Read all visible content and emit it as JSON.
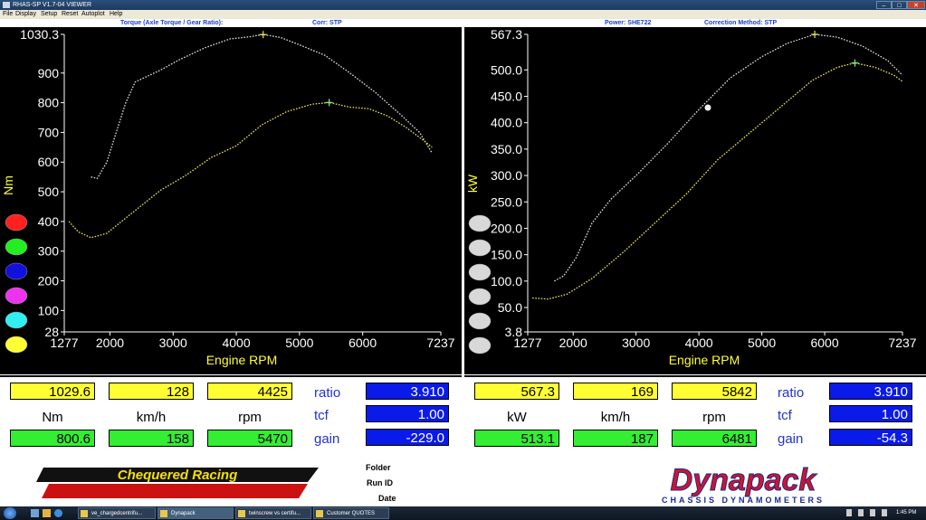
{
  "window": {
    "title": "RHAS-SP V1.7-04  VIEWER"
  },
  "menu": [
    "File",
    "Display",
    "Setup",
    "Reset",
    "Autoplot",
    "Help"
  ],
  "headers": {
    "left_title": "Torque (Axle Torque / Gear Ratio):",
    "left_corr": "Corr: STP",
    "right_power": "Power: SHE722",
    "right_corr": "Correction Method: STP"
  },
  "chart_data": [
    {
      "type": "line",
      "ylabel": "Nm",
      "xlabel": "Engine RPM",
      "xlim": [
        1277,
        7237
      ],
      "ylim": [
        28,
        1030.3
      ],
      "x_ticks": [
        "1277",
        "2000",
        "3000",
        "4000",
        "5000",
        "6000",
        "7237"
      ],
      "y_ticks": [
        "1030.3",
        "900",
        "800",
        "700",
        "600",
        "500",
        "400",
        "300",
        "200",
        "100",
        "28"
      ],
      "grid": false,
      "series": [
        {
          "color": "#e0e0e0",
          "points": [
            [
              1700,
              550
            ],
            [
              1800,
              545
            ],
            [
              1950,
              600
            ],
            [
              2100,
              700
            ],
            [
              2250,
              800
            ],
            [
              2400,
              870
            ],
            [
              2550,
              885
            ],
            [
              2800,
              910
            ],
            [
              3100,
              945
            ],
            [
              3500,
              985
            ],
            [
              3900,
              1015
            ],
            [
              4200,
              1022
            ],
            [
              4425,
              1029.6
            ],
            [
              4700,
              1020
            ],
            [
              5000,
              995
            ],
            [
              5400,
              960
            ],
            [
              5800,
              900
            ],
            [
              6200,
              835
            ],
            [
              6600,
              760
            ],
            [
              6900,
              700
            ],
            [
              7100,
              630
            ]
          ]
        },
        {
          "color": "#e6e655",
          "points": [
            [
              1350,
              400
            ],
            [
              1500,
              365
            ],
            [
              1700,
              345
            ],
            [
              1950,
              360
            ],
            [
              2300,
              420
            ],
            [
              2800,
              505
            ],
            [
              3200,
              555
            ],
            [
              3600,
              615
            ],
            [
              4000,
              655
            ],
            [
              4400,
              725
            ],
            [
              4800,
              770
            ],
            [
              5200,
              795
            ],
            [
              5470,
              800.6
            ],
            [
              5800,
              785
            ],
            [
              6100,
              780
            ],
            [
              6400,
              755
            ],
            [
              6700,
              715
            ],
            [
              6950,
              675
            ],
            [
              7100,
              650
            ]
          ]
        }
      ],
      "markers": [
        {
          "x": 4425,
          "y": 1029.6,
          "color": "#e6e655"
        },
        {
          "x": 5470,
          "y": 800.6,
          "color": "#88ee88"
        }
      ]
    },
    {
      "type": "line",
      "ylabel": "kW",
      "xlabel": "Engine RPM",
      "xlim": [
        1277,
        7237
      ],
      "ylim": [
        3.8,
        567.3
      ],
      "x_ticks": [
        "1277",
        "2000",
        "3000",
        "4000",
        "5000",
        "6000",
        "7237"
      ],
      "y_ticks": [
        "567.3",
        "500.0",
        "450.0",
        "400.0",
        "350.0",
        "300.0",
        "250.0",
        "200.0",
        "150.0",
        "100.0",
        "50.0",
        "3.8"
      ],
      "grid": false,
      "series": [
        {
          "color": "#e0e0e0",
          "points": [
            [
              1700,
              100
            ],
            [
              1850,
              110
            ],
            [
              2050,
              145
            ],
            [
              2300,
              210
            ],
            [
              2600,
              255
            ],
            [
              3000,
              300
            ],
            [
              3500,
              360
            ],
            [
              4000,
              425
            ],
            [
              4500,
              485
            ],
            [
              5000,
              525
            ],
            [
              5400,
              550
            ],
            [
              5842,
              567.3
            ],
            [
              6200,
              562
            ],
            [
              6600,
              545
            ],
            [
              7000,
              518
            ],
            [
              7237,
              490
            ]
          ]
        },
        {
          "color": "#e6e655",
          "points": [
            [
              1350,
              68
            ],
            [
              1600,
              66
            ],
            [
              1900,
              75
            ],
            [
              2300,
              105
            ],
            [
              2800,
              155
            ],
            [
              3300,
              210
            ],
            [
              3800,
              265
            ],
            [
              4300,
              330
            ],
            [
              4800,
              380
            ],
            [
              5300,
              430
            ],
            [
              5800,
              480
            ],
            [
              6200,
              505
            ],
            [
              6481,
              513.1
            ],
            [
              6800,
              505
            ],
            [
              7100,
              490
            ],
            [
              7237,
              478
            ]
          ]
        }
      ],
      "markers": [
        {
          "x": 5842,
          "y": 567.3,
          "color": "#e6e655"
        },
        {
          "x": 6481,
          "y": 513.1,
          "color": "#88ee88"
        }
      ]
    }
  ],
  "left_panel": {
    "unit": "Nm",
    "yellow": {
      "value": "1029.6",
      "speed": "128",
      "rpm": "4425"
    },
    "green": {
      "value": "800.6",
      "speed": "158",
      "rpm": "5470"
    },
    "labels": {
      "speed": "km/h",
      "rpm": "rpm"
    },
    "ratio_label": "ratio",
    "ratio": "3.910",
    "tcf_label": "tcf",
    "tcf": "1.00",
    "gain_label": "gain",
    "gain": "-229.0"
  },
  "right_panel": {
    "unit": "kW",
    "yellow": {
      "value": "567.3",
      "speed": "169",
      "rpm": "5842"
    },
    "green": {
      "value": "513.1",
      "speed": "187",
      "rpm": "6481"
    },
    "labels": {
      "speed": "km/h",
      "rpm": "rpm"
    },
    "ratio_label": "ratio",
    "ratio": "3.910",
    "tcf_label": "tcf",
    "tcf": "1.00",
    "gain_label": "gain",
    "gain": "-54.3"
  },
  "colors": {
    "swatches": [
      "#ff2020",
      "#22ee22",
      "#1111dd",
      "#ee33ee",
      "#33eeee",
      "#ffff33"
    ]
  },
  "footer": {
    "folder_label": "Folder",
    "runid_label": "Run ID",
    "date_label": "Date",
    "logo_left": "Chequered Racing",
    "logo_right": "Dynapack",
    "logo_right_sub": "CHASSIS DYNAMOMETERS"
  },
  "taskbar": {
    "items": [
      "ve_chargedcentrifu...",
      "Dynapack",
      "twinscrew vs certifu...",
      "Customer QUOTES"
    ],
    "clock": "1:45 PM"
  }
}
